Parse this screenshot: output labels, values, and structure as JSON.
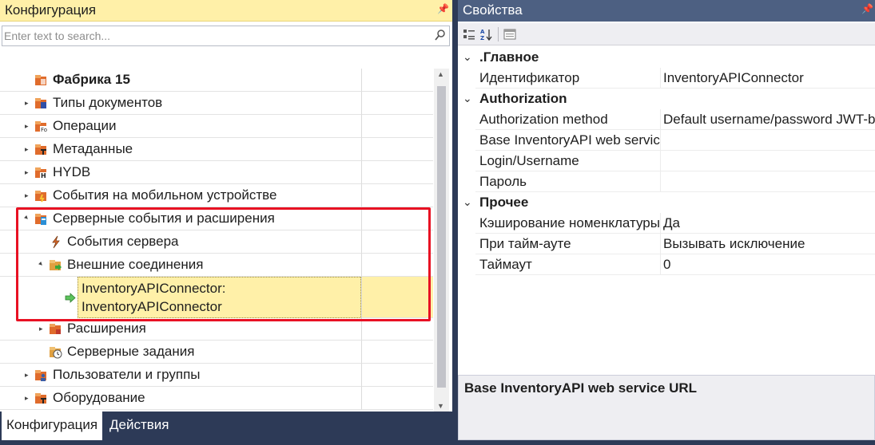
{
  "config_panel": {
    "title": "Конфигурация",
    "search_placeholder": "Enter text to search...",
    "tree": [
      {
        "label": "Фабрика 15",
        "icon": "config-root-icon"
      },
      {
        "label": "Типы документов",
        "icon": "document-types-icon"
      },
      {
        "label": "Операции",
        "icon": "operations-icon"
      },
      {
        "label": "Метаданные",
        "icon": "metadata-icon"
      },
      {
        "label": "HYDB",
        "icon": "hydb-icon"
      },
      {
        "label": "События на мобильном устройстве",
        "icon": "mobile-events-icon"
      },
      {
        "label": "Серверные события и расширения",
        "icon": "server-events-icon"
      },
      {
        "label": "События сервера",
        "icon": "lightning-icon"
      },
      {
        "label": "Внешние соединения",
        "icon": "external-connections-icon"
      },
      {
        "label": "InventoryAPIConnector: InventoryAPIConnector",
        "icon": "connector-arrow-icon"
      },
      {
        "label": "Расширения",
        "icon": "extensions-icon"
      },
      {
        "label": "Серверные задания",
        "icon": "server-tasks-clock-icon"
      },
      {
        "label": "Пользователи и группы",
        "icon": "users-groups-icon"
      },
      {
        "label": "Оборудование",
        "icon": "equipment-icon"
      }
    ],
    "tabs": [
      "Конфигурация",
      "Действия"
    ]
  },
  "properties_panel": {
    "title": "Свойства",
    "categories": [
      {
        "label": ".Главное",
        "props": [
          {
            "name": "Идентификатор",
            "value": "InventoryAPIConnector"
          }
        ]
      },
      {
        "label": "Authorization",
        "props": [
          {
            "name": "Authorization method",
            "value": "Default username/password JWT-b"
          },
          {
            "name": "Base InventoryAPI web service",
            "value": ""
          },
          {
            "name": "Login/Username",
            "value": ""
          },
          {
            "name": "Пароль",
            "value": ""
          }
        ]
      },
      {
        "label": "Прочее",
        "props": [
          {
            "name": "Кэширование номенклатуры",
            "value": "Да"
          },
          {
            "name": "При тайм-ауте",
            "value": "Вызывать исключение"
          },
          {
            "name": "Таймаут",
            "value": "0"
          }
        ]
      }
    ],
    "description": "Base InventoryAPI web service URL"
  },
  "colors": {
    "active_title": "#fff0a8",
    "inactive_title": "#4d6082",
    "frame": "#2d3a57",
    "selection_border": "#e81123"
  }
}
